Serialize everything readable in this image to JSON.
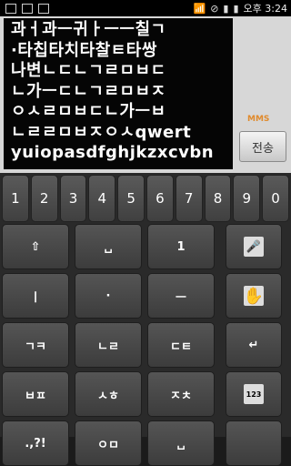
{
  "status_bar": {
    "time": "오후 3:24"
  },
  "message": {
    "lines": [
      "과ㅓ과ㅡ귀ㅏㅡㅡ칠ㄱ",
      "·타칩타치타찰ㅌ타쌍",
      "나변ㄴㄷㄴㄱㄹㅁㅂㄷ",
      "ㄴ가ㅡㄷㄴㄱㄹㅁㅂㅈ",
      "ㅇㅅㄹㅁㅂㄷㄴ가ㅡㅂ",
      "ㄴㄹㄹㅁㅂㅈㅇㅅqwert",
      "yuiopasdfghjkzxcvbn"
    ],
    "mms_label": "MMS",
    "send_label": "전송"
  },
  "keyboard": {
    "numbers": [
      "1",
      "2",
      "3",
      "4",
      "5",
      "6",
      "7",
      "8",
      "9",
      "0"
    ],
    "rows": [
      [
        "⇧",
        "␣",
        "1",
        "mic"
      ],
      [
        "ㅣ",
        "·",
        "ㅡ",
        "hand"
      ],
      [
        "ㄱㅋ",
        "ㄴㄹ",
        "ㄷㅌ",
        "↵"
      ],
      [
        "ㅂㅍ",
        "ㅅㅎ",
        "ㅈㅊ",
        "123"
      ],
      [
        ".,?!",
        "ㅇㅁ",
        "␣",
        ""
      ]
    ]
  }
}
